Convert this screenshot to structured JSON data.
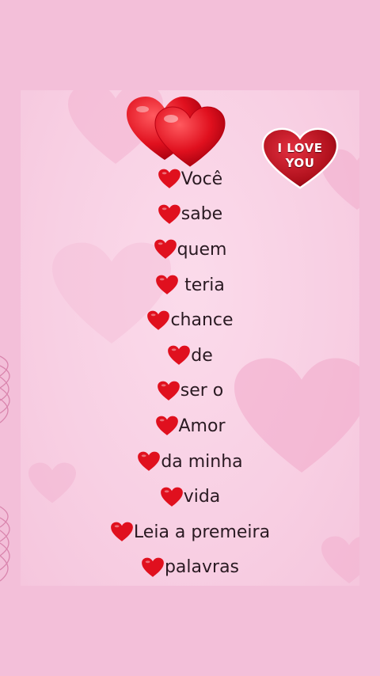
{
  "badge": {
    "line1": "I LOVE",
    "line2": "YOU"
  },
  "words": [
    "Você",
    "sabe",
    "quem",
    " teria",
    "chance",
    "de",
    "ser o",
    "Amor",
    "da minha",
    "vida",
    "Leia a premeira",
    "palavras"
  ],
  "colors": {
    "background": "#f3bfd9",
    "heart": "#e0101e",
    "badge": "#b0101c"
  },
  "icons": {
    "list_bullet": "red-heart-icon",
    "top_decoration": "double-red-heart-icon",
    "badge_shape": "heart-icon"
  }
}
